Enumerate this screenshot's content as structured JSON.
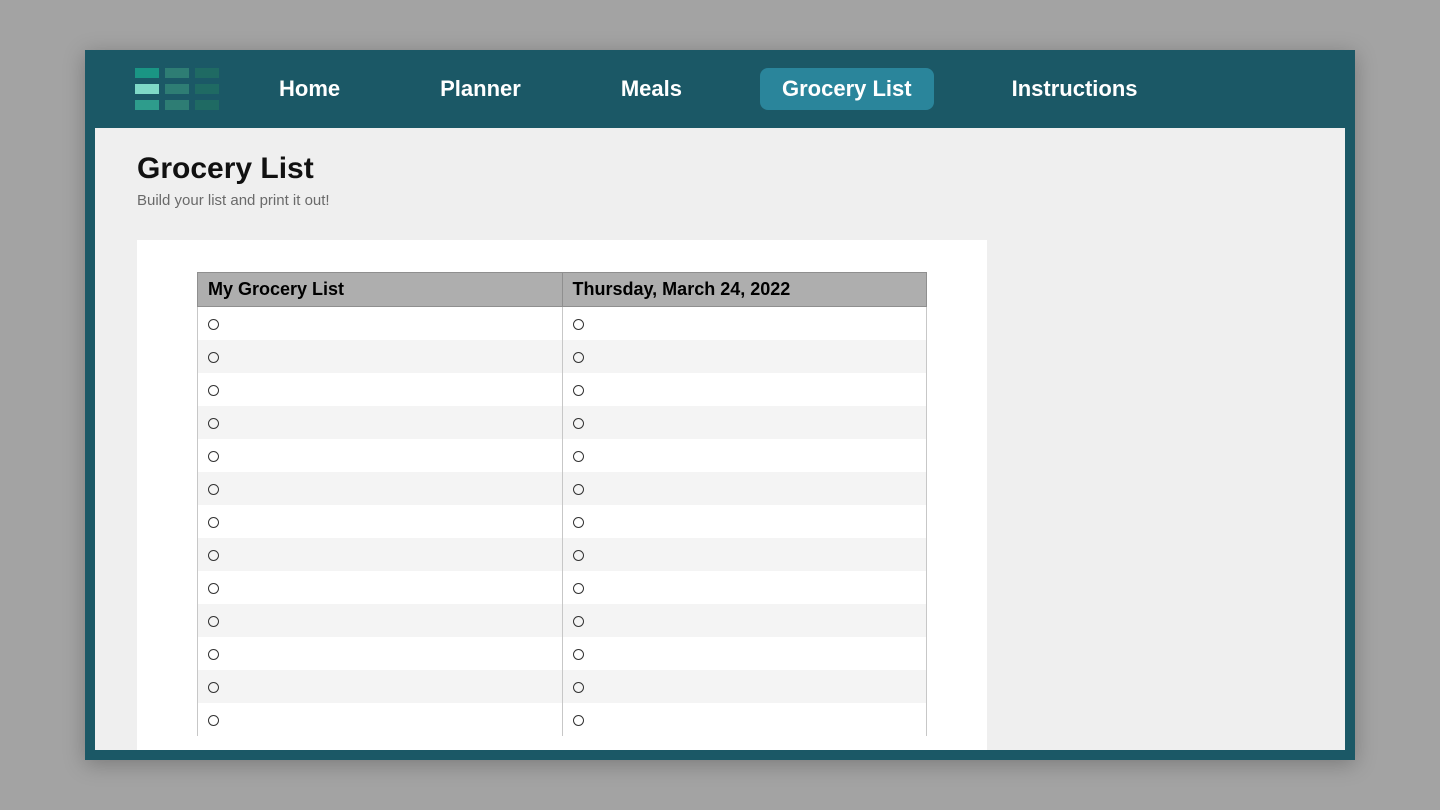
{
  "nav": {
    "items": [
      {
        "label": "Home",
        "active": false
      },
      {
        "label": "Planner",
        "active": false
      },
      {
        "label": "Meals",
        "active": false
      },
      {
        "label": "Grocery List",
        "active": true
      },
      {
        "label": "Instructions",
        "active": false
      }
    ]
  },
  "page": {
    "title": "Grocery List",
    "subtitle": "Build your list and print it out!"
  },
  "grocery_table": {
    "header_left": "My Grocery List",
    "header_right": "Thursday, March 24, 2022",
    "row_count": 13,
    "columns": 2,
    "rows": [
      [
        "",
        ""
      ],
      [
        "",
        ""
      ],
      [
        "",
        ""
      ],
      [
        "",
        ""
      ],
      [
        "",
        ""
      ],
      [
        "",
        ""
      ],
      [
        "",
        ""
      ],
      [
        "",
        ""
      ],
      [
        "",
        ""
      ],
      [
        "",
        ""
      ],
      [
        "",
        ""
      ],
      [
        "",
        ""
      ],
      [
        "",
        ""
      ]
    ]
  }
}
